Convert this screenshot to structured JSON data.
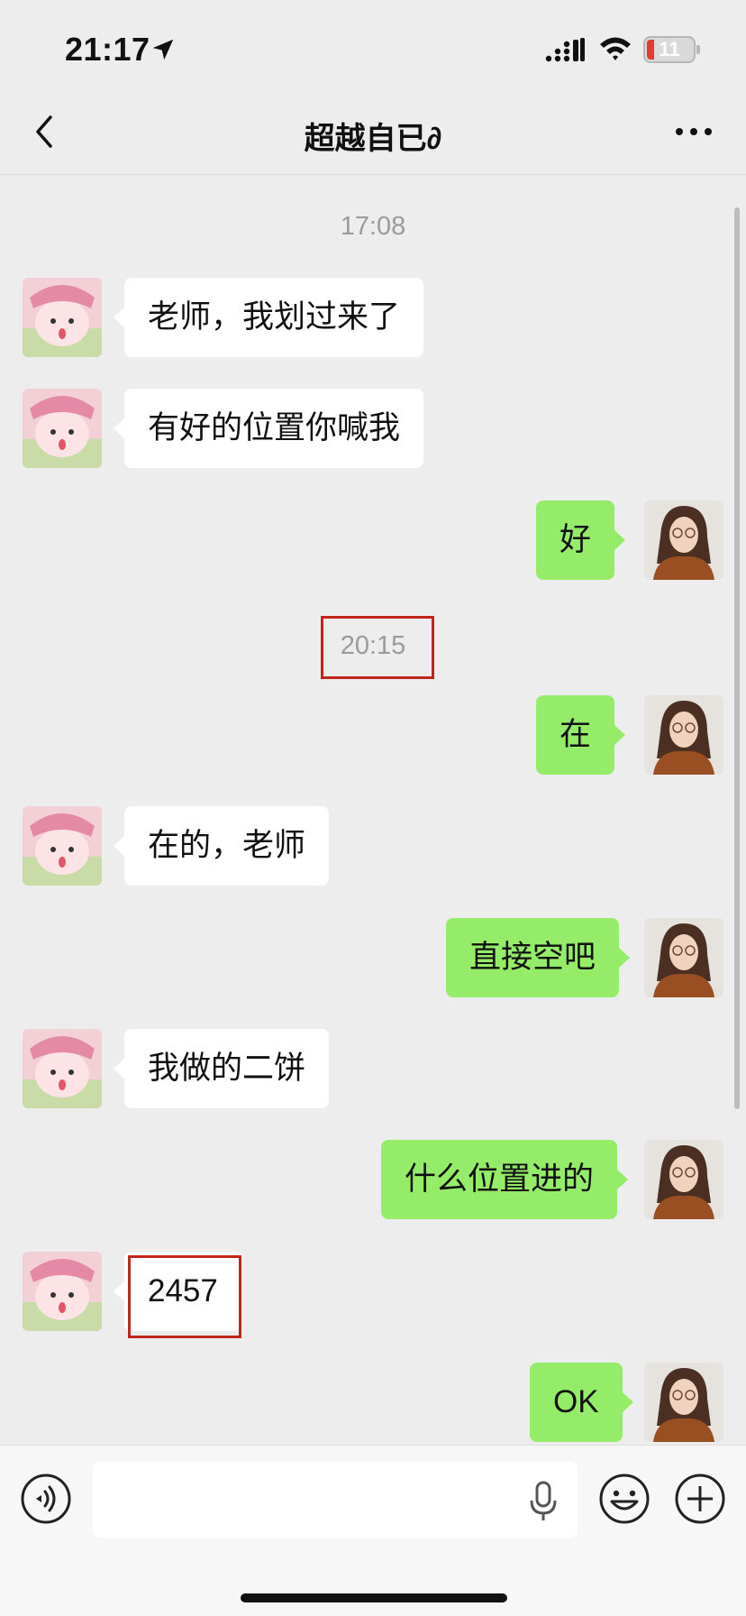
{
  "status_bar": {
    "time": "21:17",
    "battery_level": "11",
    "icons": [
      "location-arrow-icon",
      "signal-icon",
      "wifi-icon",
      "battery-icon"
    ],
    "battery_color": "#e33b2e"
  },
  "nav": {
    "title": "超越自已∂",
    "back_icon": "chevron-left-icon",
    "more_icon": "more-icon"
  },
  "chat": {
    "bubble_colors": {
      "incoming": "#ffffff",
      "outgoing": "#95ec69"
    },
    "highlight_color": "#c0261a",
    "timestamps": [
      "17:08",
      "20:15"
    ],
    "messages": [
      {
        "from": "other",
        "text": "老师，我划过来了"
      },
      {
        "from": "other",
        "text": "有好的位置你喊我"
      },
      {
        "from": "me",
        "text": "好"
      },
      {
        "from": "me",
        "text": "在"
      },
      {
        "from": "other",
        "text": "在的，老师"
      },
      {
        "from": "me",
        "text": "直接空吧"
      },
      {
        "from": "other",
        "text": "我做的二饼"
      },
      {
        "from": "me",
        "text": "什么位置进的"
      },
      {
        "from": "other",
        "text": "2457"
      },
      {
        "from": "me",
        "text": "OK"
      }
    ]
  },
  "input_bar": {
    "value": "",
    "icons": [
      "voice-icon",
      "mic-icon",
      "emoji-icon",
      "plus-icon"
    ]
  }
}
